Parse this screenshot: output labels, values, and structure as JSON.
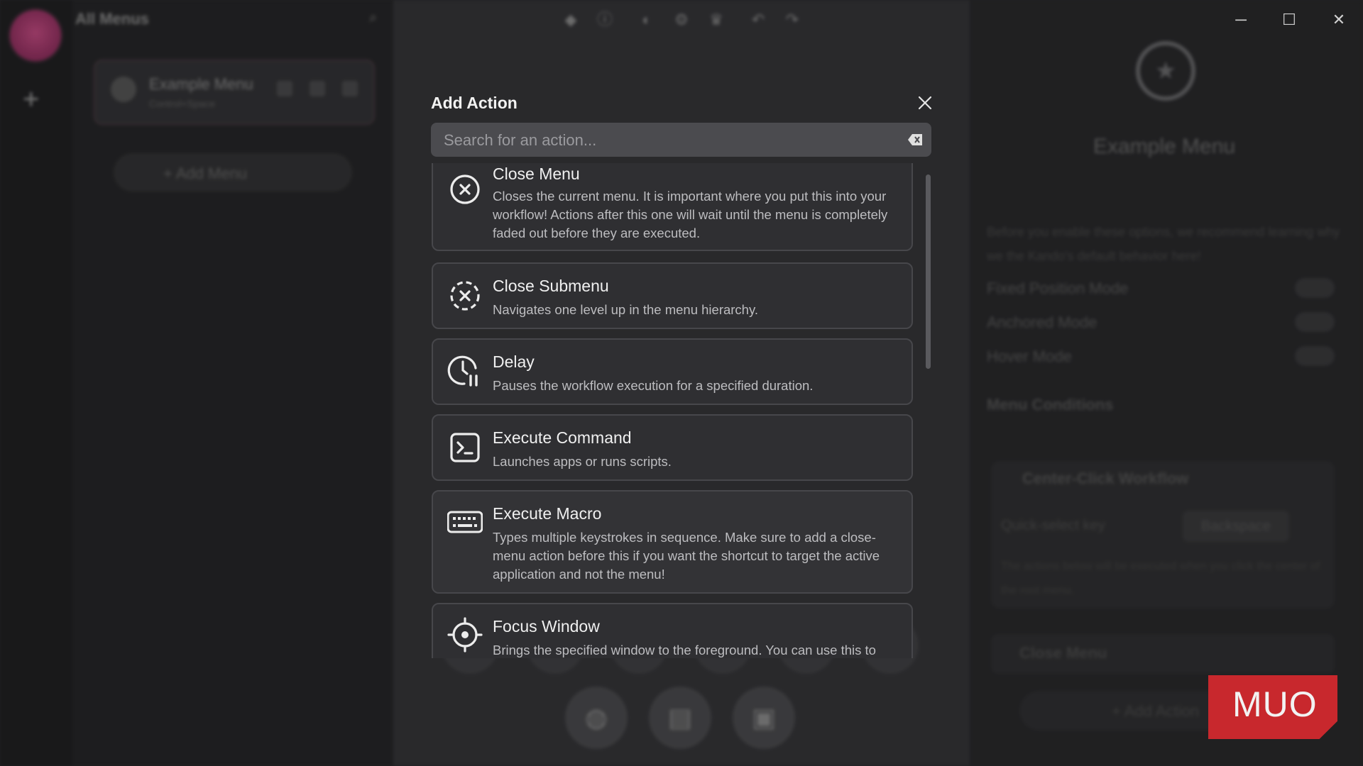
{
  "app": {
    "menus_title": "All Menus",
    "example_menu_name": "Example Menu",
    "example_menu_shortcut": "Control+Space",
    "add_menu_label": "+ Add Menu",
    "props": {
      "menu_name": "Example Menu",
      "hint": "Before you enable these options, we recommend learning why we the Kando's default behavior here!",
      "fixed_position": "Fixed Position Mode",
      "anchored": "Anchored Mode",
      "hover": "Hover Mode",
      "conditions": "Menu Conditions",
      "workflow_title": "Center-Click Workflow",
      "quick_select_key": "Quick-select key",
      "quick_select_value": "Backspace",
      "workflow_desc": "The actions below will be executed when you click the center of the root menu.",
      "close_menu_step": "Close Menu",
      "add_action": "+ Add Action"
    }
  },
  "dialog": {
    "title": "Add Action",
    "search_placeholder": "Search for an action...",
    "actions": [
      {
        "name": "Close Menu",
        "icon": "close-circle-icon",
        "desc": "Closes the current menu. It is important where you put this into your workflow! Actions after this one will wait until the menu is completely faded out before they are executed."
      },
      {
        "name": "Close Submenu",
        "icon": "close-dashed-circle-icon",
        "desc": "Navigates one level up in the menu hierarchy."
      },
      {
        "name": "Delay",
        "icon": "clock-pause-icon",
        "desc": "Pauses the workflow execution for a specified duration."
      },
      {
        "name": "Execute Command",
        "icon": "terminal-icon",
        "desc": "Launches apps or runs scripts."
      },
      {
        "name": "Execute Macro",
        "icon": "keyboard-icon",
        "desc": "Types multiple keystrokes in sequence. Make sure to add a close-menu action before this if you want the shortcut to target the active application and not the menu!"
      },
      {
        "name": "Focus Window",
        "icon": "crosshair-icon",
        "desc": "Brings the specified window to the foreground. You can use this to"
      }
    ]
  },
  "watermark": "MUO",
  "colors": {
    "dialog_bg": "#2a2a2d",
    "card_bg": "#2f2f32",
    "card_border": "#47474b",
    "search_bg": "#4b4b4f",
    "watermark_red": "#c8282d"
  }
}
